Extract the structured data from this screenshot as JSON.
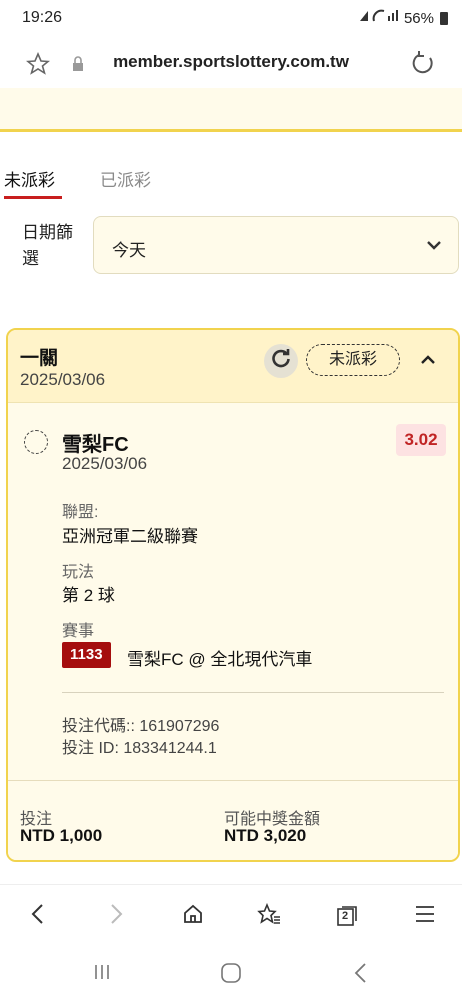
{
  "status_bar": {
    "time": "19:26",
    "battery_percent": "56%"
  },
  "browser": {
    "url": "member.sportslottery.com.tw"
  },
  "tabs": [
    {
      "label": "未派彩",
      "active": true
    },
    {
      "label": "已派彩",
      "active": false
    }
  ],
  "filter": {
    "label": "日期篩選",
    "selected": "今天"
  },
  "bet_card": {
    "title": "一關",
    "date": "2025/03/06",
    "status": "未派彩",
    "selection": {
      "team": "雪梨FC",
      "date": "2025/03/06",
      "odds": "3.02",
      "league_label": "聯盟:",
      "league": "亞洲冠軍二級聯賽",
      "play_label": "玩法",
      "play": "第 2 球",
      "event_label": "賽事",
      "event_code": "1133",
      "event_name": "雪梨FC @ 全北現代汽車"
    },
    "bet_code": "投注代碼:: 161907296",
    "bet_id": "投注 ID: 183341244.1",
    "stake_label": "投注",
    "stake_value": "NTD 1,000",
    "payout_label": "可能中獎金額",
    "payout_value": "NTD 3,020"
  },
  "colors": {
    "accent_red": "#c81e1e",
    "card_border": "#f1d34e",
    "card_bg": "#fffbea"
  },
  "icons": {
    "star": "star-icon",
    "lock": "lock-icon",
    "reload": "reload-icon",
    "back": "back-icon",
    "forward": "forward-icon",
    "home": "home-icon",
    "bookmarks": "bookmarks-icon",
    "tabs": "tabs-icon",
    "menu": "menu-icon"
  },
  "toolbar": {
    "tab_count": "2"
  }
}
